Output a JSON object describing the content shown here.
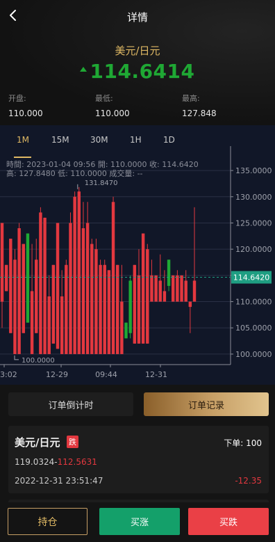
{
  "header": {
    "title": "详情",
    "pair": "美元/日元",
    "price": "114.6414",
    "stats": [
      {
        "label": "开盘:",
        "value": "110.000"
      },
      {
        "label": "最低:",
        "value": "110.000"
      },
      {
        "label": "最高:",
        "value": "127.848"
      }
    ]
  },
  "chart": {
    "tabs": [
      "1M",
      "15M",
      "30M",
      "1H",
      "1D"
    ],
    "active_tab": "1M",
    "info_line1": "時間: 2023-01-04 09:56   開: 110.0000   收: 114.6420",
    "info_line2": "高: 127.8480   低: 110.0000   成交量: --",
    "current_price_label": "114.6420",
    "max_label": "131.8470",
    "min_label": "100.0000"
  },
  "chart_data": {
    "type": "candlestick",
    "y_ticks": [
      "135.0000",
      "130.0000",
      "125.0000",
      "120.0000",
      "115.0000",
      "110.0000",
      "105.0000",
      "100.0000"
    ],
    "ylim": [
      98,
      137
    ],
    "x_ticks": [
      "3:02",
      "12-29",
      "09:44",
      "12-31"
    ],
    "current_price": 114.642,
    "candles": [
      {
        "o": 125,
        "c": 110,
        "h": 125,
        "l": 105
      },
      {
        "o": 117,
        "c": 112,
        "h": 117,
        "l": 112
      },
      {
        "o": 122,
        "c": 104,
        "h": 122,
        "l": 104
      },
      {
        "o": 118,
        "c": 100,
        "h": 120,
        "l": 100
      },
      {
        "o": 124,
        "c": 100,
        "h": 125,
        "l": 100
      },
      {
        "o": 121,
        "c": 104,
        "h": 121,
        "l": 104
      },
      {
        "o": 106,
        "c": 123,
        "h": 123,
        "l": 106
      },
      {
        "o": 112,
        "c": 100,
        "h": 121,
        "l": 100
      },
      {
        "o": 118,
        "c": 104,
        "h": 122,
        "l": 104
      },
      {
        "o": 127,
        "c": 100,
        "h": 128,
        "l": 100
      },
      {
        "o": 126,
        "c": 100,
        "h": 126,
        "l": 100
      },
      {
        "o": 111,
        "c": 100,
        "h": 115,
        "l": 100
      },
      {
        "o": 117,
        "c": 102,
        "h": 117,
        "l": 102
      },
      {
        "o": 125,
        "c": 101,
        "h": 125,
        "l": 101
      },
      {
        "o": 111,
        "c": 100,
        "h": 116,
        "l": 100
      },
      {
        "o": 117,
        "c": 100,
        "h": 118,
        "l": 100
      },
      {
        "o": 125,
        "c": 100,
        "h": 127,
        "l": 100
      },
      {
        "o": 130,
        "c": 100,
        "h": 131,
        "l": 100
      },
      {
        "o": 131,
        "c": 100,
        "h": 131.847,
        "l": 100
      },
      {
        "o": 124,
        "c": 100,
        "h": 129,
        "l": 100
      },
      {
        "o": 125,
        "c": 100,
        "h": 129,
        "l": 100
      },
      {
        "o": 121,
        "c": 100,
        "h": 122,
        "l": 100
      },
      {
        "o": 120,
        "c": 100,
        "h": 122,
        "l": 100
      },
      {
        "o": 117,
        "c": 100,
        "h": 118,
        "l": 100
      },
      {
        "o": 117,
        "c": 100,
        "h": 118,
        "l": 100
      },
      {
        "o": 116,
        "c": 100,
        "h": 116,
        "l": 100
      },
      {
        "o": 129,
        "c": 100,
        "h": 130,
        "l": 100
      },
      {
        "o": 117,
        "c": 100,
        "h": 117,
        "l": 100
      },
      {
        "o": 110,
        "c": 100,
        "h": 117,
        "l": 100
      },
      {
        "o": 103,
        "c": 106,
        "h": 106,
        "l": 103
      },
      {
        "o": 104,
        "c": 114,
        "h": 115,
        "l": 103
      },
      {
        "o": 117,
        "c": 102,
        "h": 117,
        "l": 102
      },
      {
        "o": 115,
        "c": 102,
        "h": 120,
        "l": 102
      },
      {
        "o": 123,
        "c": 102,
        "h": 123,
        "l": 102
      },
      {
        "o": 120,
        "c": 102,
        "h": 121,
        "l": 102
      },
      {
        "o": 115,
        "c": 110,
        "h": 118,
        "l": 110
      },
      {
        "o": 115,
        "c": 110,
        "h": 115,
        "l": 110
      },
      {
        "o": 114,
        "c": 110,
        "h": 119,
        "l": 110
      },
      {
        "o": 112,
        "c": 110,
        "h": 116,
        "l": 110
      },
      {
        "o": 113,
        "c": 118,
        "h": 118,
        "l": 112
      },
      {
        "o": 115,
        "c": 110,
        "h": 115,
        "l": 110
      },
      {
        "o": 115,
        "c": 110,
        "h": 116,
        "l": 110
      },
      {
        "o": 115,
        "c": 110,
        "h": 115,
        "l": 110
      },
      {
        "o": 114,
        "c": 110,
        "h": 116,
        "l": 110
      },
      {
        "o": 110,
        "c": 109,
        "h": 110,
        "l": 104
      },
      {
        "o": 114,
        "c": 110,
        "h": 128,
        "l": 110
      }
    ]
  },
  "actions": {
    "countdown_label": "订单倒计时",
    "records_label": "订单记录"
  },
  "order": {
    "pair": "美元/日元",
    "badge": "跌",
    "qty_label": "下单: 100",
    "price_open": "119.0324",
    "price_sep": "-",
    "price_close": "112.5631",
    "time": "2022-12-31 23:51:47",
    "pl": "-12.35"
  },
  "bottom": {
    "hold_label": "持仓",
    "buy_up_label": "买涨",
    "buy_down_label": "买跌"
  },
  "colors": {
    "up": "#1fa834",
    "down": "#e3383f",
    "accent_gold": "#e0b964",
    "chart_bg": "#111728",
    "price_tag": "#1f9e82"
  }
}
